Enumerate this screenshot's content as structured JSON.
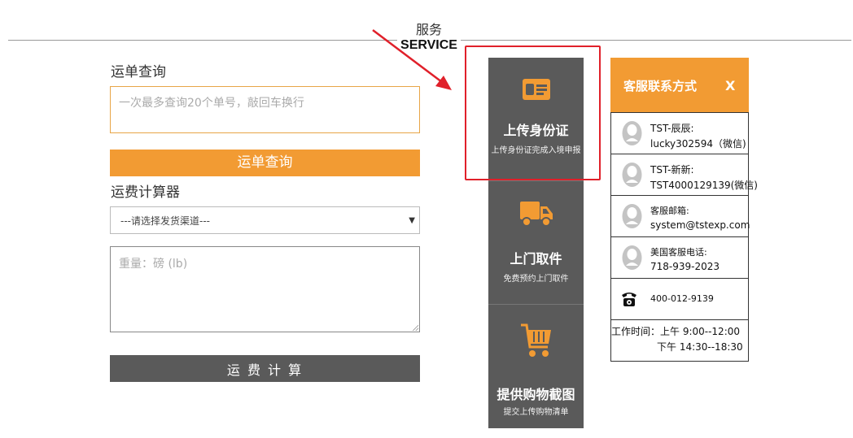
{
  "section": {
    "title_cn": "服务",
    "title_en": "SERVICE"
  },
  "tracking": {
    "label": "运单查询",
    "placeholder": "一次最多查询20个单号，敲回车换行",
    "button": "运单查询"
  },
  "calculator": {
    "label": "运费计算器",
    "channel_select": "---请选择发货渠道---",
    "weight_placeholder": "重量：磅  (lb)",
    "button": "运 费 计 算"
  },
  "services": [
    {
      "title": "上传身份证",
      "subtitle": "上传身份证完成入境申报",
      "icon": "id-card-icon"
    },
    {
      "title": "上门取件",
      "subtitle": "免费预约上门取件",
      "icon": "truck-icon"
    },
    {
      "title": "提供购物截图",
      "subtitle": "提交上传购物清单",
      "icon": "cart-icon"
    }
  ],
  "customer_service": {
    "title": "客服联系方式",
    "close": "X",
    "contacts": [
      {
        "line1": "TST-辰辰:",
        "line2": "lucky302594（微信)",
        "icon": "qq-icon"
      },
      {
        "line1": "TST-新新:",
        "line2": "TST4000129139(微信)",
        "icon": "qq-icon"
      },
      {
        "line1": "客服邮箱:",
        "line2": "system@tstexp.com",
        "icon": "qq-icon"
      },
      {
        "line1": "美国客服电话:",
        "line2": "718-939-2023",
        "icon": "qq-icon"
      },
      {
        "line1": "400-012-9139",
        "icon": "phone-icon"
      }
    ],
    "hours_line1": "工作时间：上午  9:00--12:00",
    "hours_line2": "下午 14:30--18:30"
  },
  "colors": {
    "accent": "#f29b33",
    "dark": "#5a5a5a",
    "highlight": "#e0202a"
  }
}
